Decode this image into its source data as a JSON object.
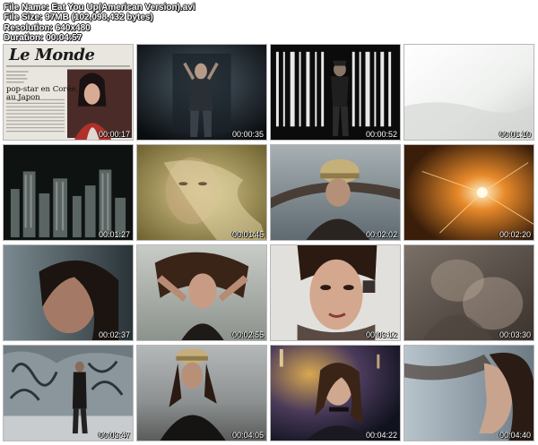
{
  "file_info": {
    "name_label": "File Name:",
    "name_value": "Eat You Up(American Version).avi",
    "size_label": "File Size:",
    "size_value": "97MB (102,098,432 bytes)",
    "resolution_label": "Resolution:",
    "resolution_value": "640x480",
    "duration_label": "Duration:",
    "duration_value": "00:04:57"
  },
  "newspaper": {
    "masthead": "Le Monde",
    "headline_line1": "pop-star en Corée,",
    "headline_line2": "au Japon"
  },
  "thumbnails": [
    {
      "timestamp": "00:00:17",
      "scene": "newspaper"
    },
    {
      "timestamp": "00:00:35",
      "scene": "dark-stage"
    },
    {
      "timestamp": "00:00:52",
      "scene": "barcode"
    },
    {
      "timestamp": "00:01:10",
      "scene": "white-fade"
    },
    {
      "timestamp": "00:01:27",
      "scene": "city-night"
    },
    {
      "timestamp": "00:01:45",
      "scene": "golden-face"
    },
    {
      "timestamp": "00:02:02",
      "scene": "cap-wind"
    },
    {
      "timestamp": "00:02:20",
      "scene": "sparkle"
    },
    {
      "timestamp": "00:02:37",
      "scene": "closeup-dark"
    },
    {
      "timestamp": "00:02:55",
      "scene": "arms-up"
    },
    {
      "timestamp": "00:03:12",
      "scene": "closeup-bright"
    },
    {
      "timestamp": "00:03:30",
      "scene": "ghost-overlay"
    },
    {
      "timestamp": "00:03:47",
      "scene": "graffiti"
    },
    {
      "timestamp": "00:04:05",
      "scene": "cap-desert"
    },
    {
      "timestamp": "00:04:22",
      "scene": "neon-portrait"
    },
    {
      "timestamp": "00:04:40",
      "scene": "profile-blue"
    }
  ]
}
